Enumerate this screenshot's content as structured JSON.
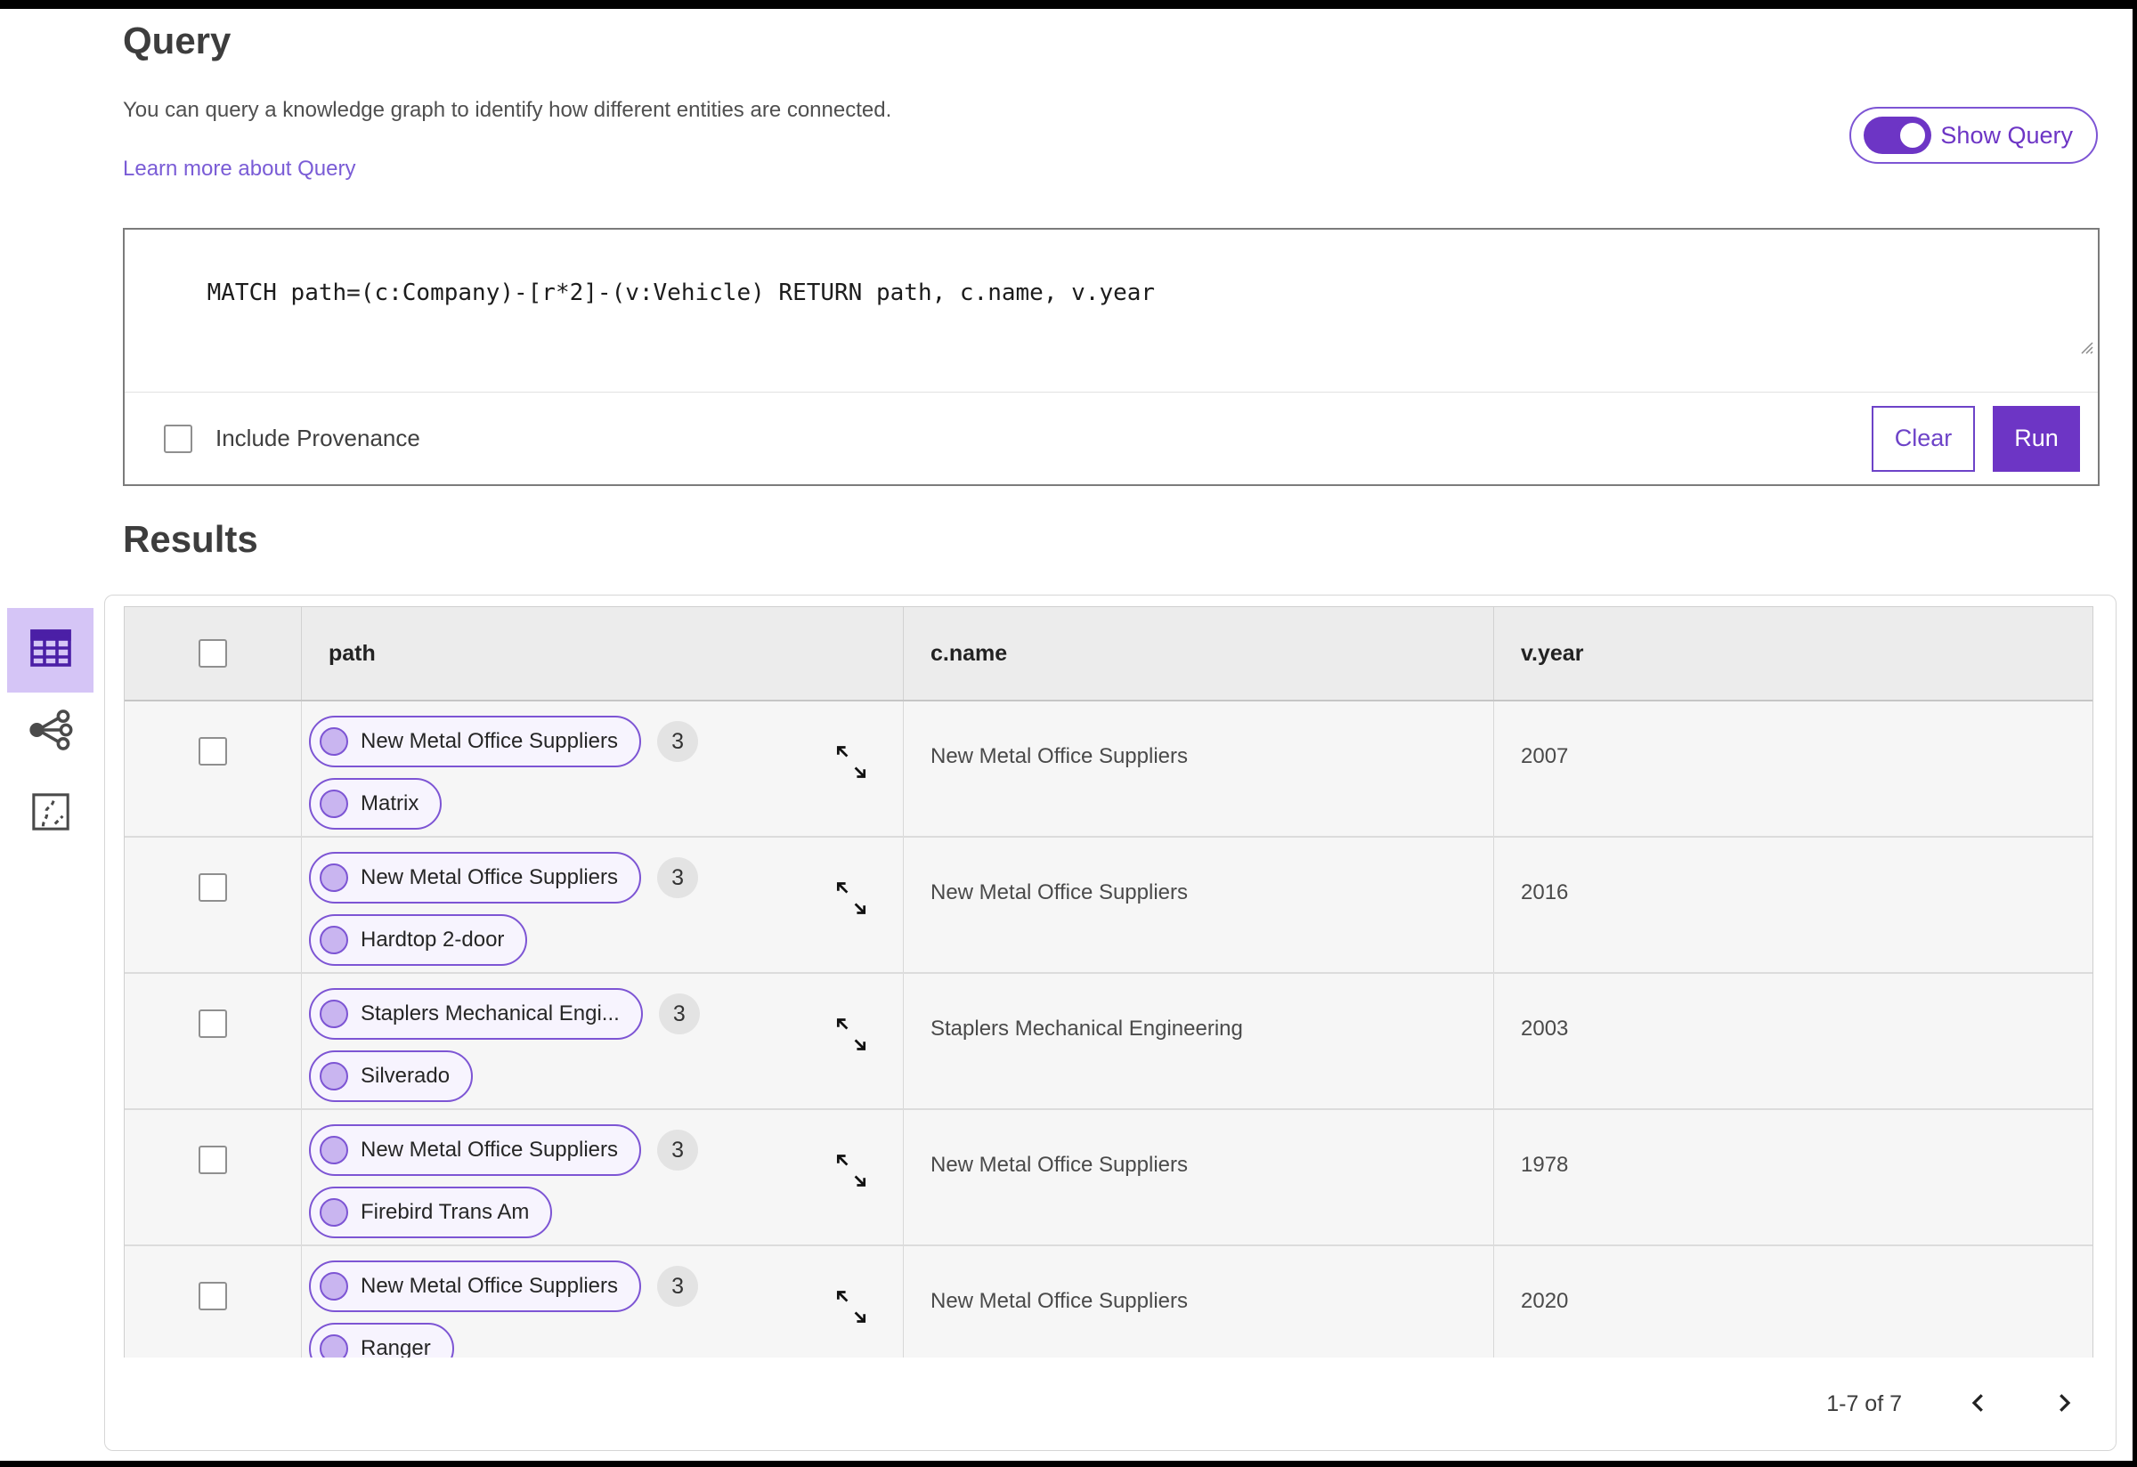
{
  "query_section": {
    "title": "Query",
    "description": "You can query a knowledge graph to identify how different entities are connected.",
    "learn_more_link": "Learn more about Query",
    "show_query_toggle": {
      "label": "Show Query",
      "state": "on"
    },
    "editor": {
      "query_text": "MATCH path=(c:Company)-[r*2]-(v:Vehicle) RETURN path, c.name, v.year",
      "include_provenance": {
        "label": "Include Provenance",
        "checked": false
      },
      "clear_label": "Clear",
      "run_label": "Run"
    }
  },
  "results_section": {
    "title": "Results",
    "view_switcher": [
      {
        "name": "table-view",
        "icon": "table-grid",
        "selected": true
      },
      {
        "name": "graph-view",
        "icon": "share-network",
        "selected": false
      },
      {
        "name": "map-view",
        "icon": "route-in-square",
        "selected": false
      }
    ],
    "table": {
      "columns": [
        "path",
        "c.name",
        "v.year"
      ],
      "rows": [
        {
          "path": {
            "nodes": [
              "New Metal Office Suppliers",
              "Matrix"
            ],
            "edge_count": "3"
          },
          "c_name": "New Metal Office Suppliers",
          "v_year": "2007"
        },
        {
          "path": {
            "nodes": [
              "New Metal Office Suppliers",
              "Hardtop 2-door"
            ],
            "edge_count": "3"
          },
          "c_name": "New Metal Office Suppliers",
          "v_year": "2016"
        },
        {
          "path": {
            "nodes": [
              "Staplers Mechanical Engi...",
              "Silverado"
            ],
            "edge_count": "3"
          },
          "c_name": "Staplers Mechanical Engineering",
          "v_year": "2003"
        },
        {
          "path": {
            "nodes": [
              "New Metal Office Suppliers",
              "Firebird Trans Am"
            ],
            "edge_count": "3"
          },
          "c_name": "New Metal Office Suppliers",
          "v_year": "1978"
        },
        {
          "path": {
            "nodes": [
              "New Metal Office Suppliers",
              "Ranger"
            ],
            "edge_count": "3"
          },
          "c_name": "New Metal Office Suppliers",
          "v_year": "2020"
        }
      ]
    },
    "pagination": {
      "range_label": "1-7 of 7",
      "prev_icon": "chevron-left",
      "next_icon": "chevron-right"
    }
  },
  "icons": {
    "table-view": "table-grid",
    "graph-view": "share-network",
    "map-view": "route-in-square",
    "expand": "diagonal-expand-arrows",
    "resize": "textarea-resize-grip"
  },
  "colors": {
    "primary_purple": "#6d35c5",
    "pill_border": "#7d55d4",
    "pill_bg": "#f7f4fe",
    "node_circle_fill": "#c9b5f0",
    "link_purple": "#7a5cd6",
    "selected_view_bg": "#d5c5f6",
    "table_header_bg": "#ececec",
    "row_bg": "#f6f6f6"
  }
}
